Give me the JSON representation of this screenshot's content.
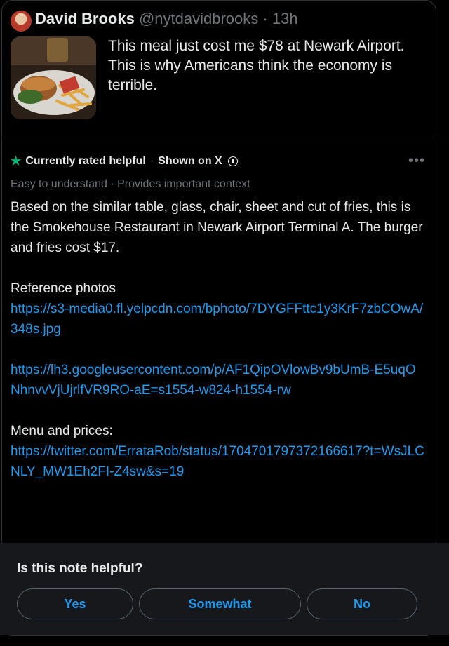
{
  "tweet": {
    "author_name": "David Brooks",
    "handle": "@nytdavidbrooks",
    "time": "13h",
    "text": "This meal just cost me $78 at Newark Airport. This is why Americans think the economy is terrible."
  },
  "note": {
    "status": "Currently rated helpful",
    "shown_on": "Shown on X",
    "tags": "Easy to understand · Provides important context",
    "body": "Based on the similar table, glass, chair, sheet and cut of fries, this is the Smokehouse Restaurant in Newark Airport Terminal A. The burger and fries cost $17.",
    "reference_label": "Reference photos",
    "link1": "https://s3-media0.fl.yelpcdn.com/bphoto/7DYGFFttc1y3KrF7zbCOwA/348s.jpg",
    "link2": "https://lh3.googleusercontent.com/p/AF1QipOVlowBv9bUmB-E5uqONhnvvVjUjrlfVR9RO-aE=s1554-w824-h1554-rw",
    "menu_label": "Menu and prices:",
    "link3": "https://twitter.com/ErrataRob/status/1704701797372166617?t=WsJLCNLY_MW1Eh2FI-Z4sw&s=19"
  },
  "feedback": {
    "question": "Is this note helpful?",
    "yes": "Yes",
    "somewhat": "Somewhat",
    "no": "No"
  },
  "colors": {
    "accent": "#1d9bf0",
    "helpful_star": "#00ba7c",
    "muted": "#71767b"
  },
  "icons": [
    "star-icon",
    "info-icon",
    "more-options-icon"
  ]
}
